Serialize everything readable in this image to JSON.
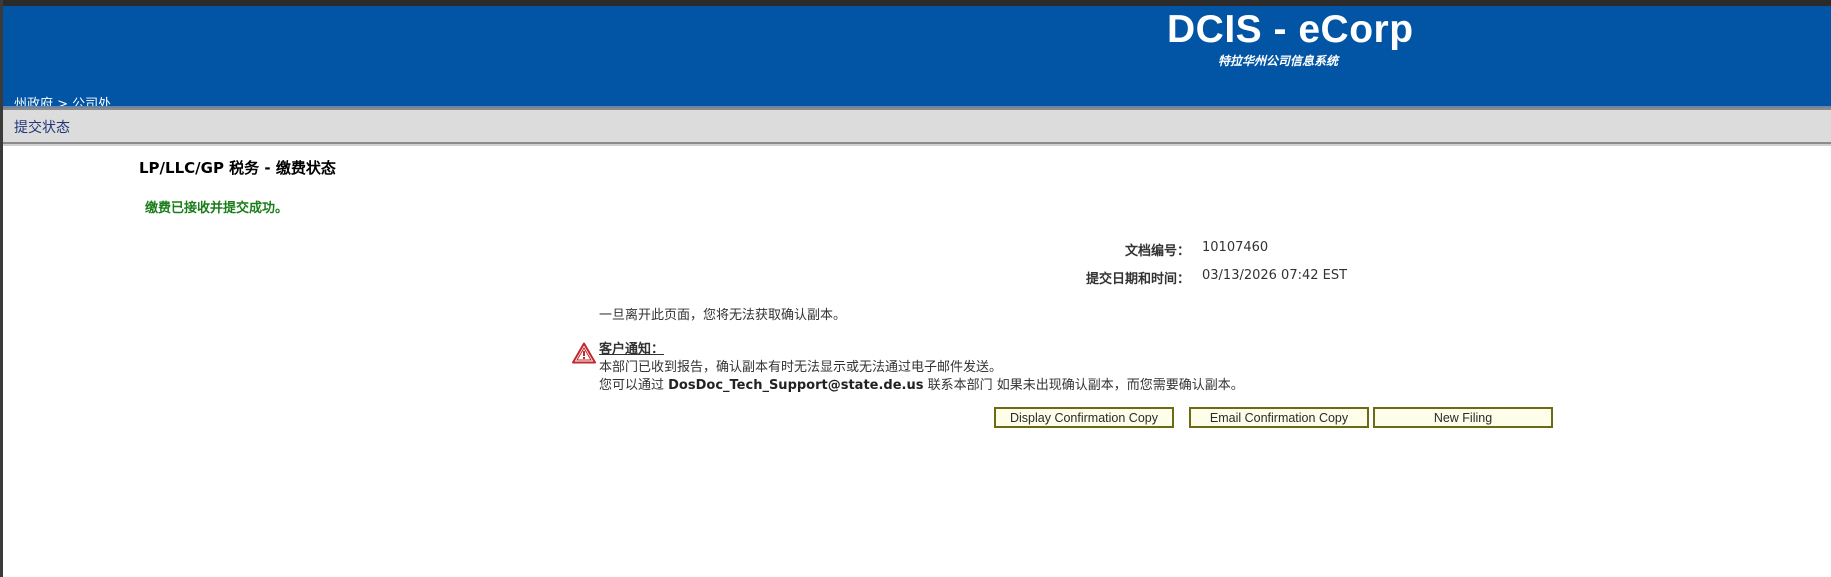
{
  "header": {
    "brand_title": "DCIS - eCorp",
    "brand_subtitle": "特拉华州公司信息系统",
    "breadcrumb": "州政府 > 公司处"
  },
  "subbar": {
    "title": "提交状态"
  },
  "main": {
    "page_title": "LP/LLC/GP 税务 - 缴费状态",
    "success_message": "缴费已接收并提交成功。",
    "doc_number_label": "文档编号：",
    "doc_number_value": "10107460",
    "submit_datetime_label": "提交日期和时间：",
    "submit_datetime_value": "03/13/2026 07:42 EST",
    "leave_page_note": "一旦离开此页面，您将无法获取确认副本。",
    "customer_notice": {
      "heading": "客户通知：",
      "line1": "本部门已收到报告，确认副本有时无法显示或无法通过电子邮件发送。",
      "line2_prefix": "您可以通过 ",
      "line2_email": "DosDoc_Tech_Support@state.de.us",
      "line2_suffix": " 联系本部门 如果未出现确认副本，而您需要确认副本。"
    },
    "buttons": {
      "display_copy": "Display Confirmation Copy",
      "email_copy": "Email Confirmation Copy",
      "new_filing": "New Filing"
    }
  },
  "colors": {
    "header_blue": "#0255a5",
    "success_green": "#1a7d1a",
    "button_border": "#6b6b16",
    "warning_red": "#c0282d"
  }
}
